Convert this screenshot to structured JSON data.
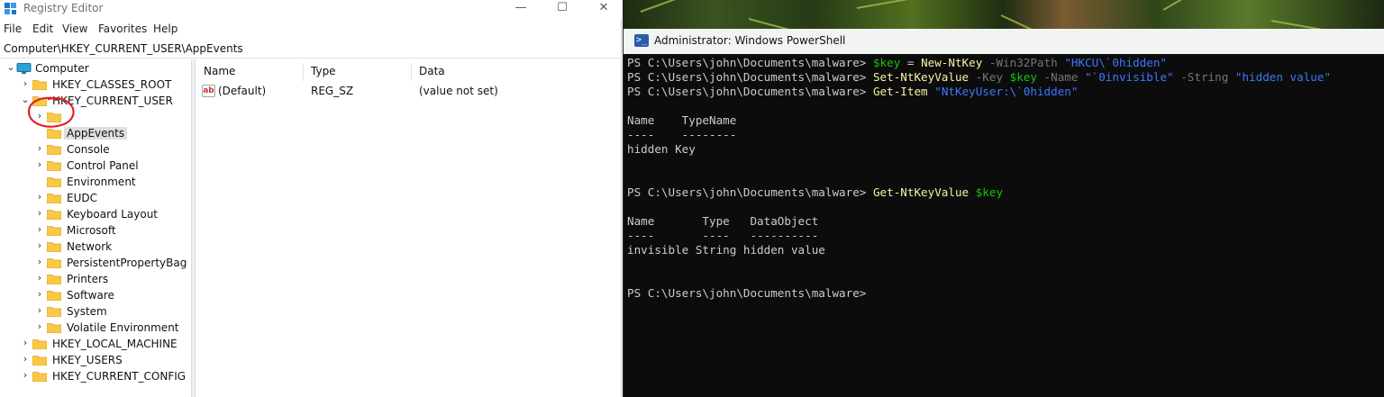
{
  "regedit": {
    "title": "Registry Editor",
    "window_buttons": {
      "minimize": "—",
      "maximize": "☐",
      "close": "✕"
    },
    "menu": [
      "File",
      "Edit",
      "View",
      "Favorites",
      "Help"
    ],
    "address": "Computer\\HKEY_CURRENT_USER\\AppEvents",
    "tree": {
      "root": "Computer",
      "hives": [
        "HKEY_CLASSES_ROOT",
        "HKEY_CURRENT_USER"
      ],
      "hkcu_children": [
        "",
        "AppEvents",
        "Console",
        "Control Panel",
        "Environment",
        "EUDC",
        "Keyboard Layout",
        "Microsoft",
        "Network",
        "PersistentPropertyBag",
        "Printers",
        "Software",
        "System",
        "Volatile Environment"
      ],
      "other_hives": [
        "HKEY_LOCAL_MACHINE",
        "HKEY_USERS",
        "HKEY_CURRENT_CONFIG"
      ],
      "selected": "AppEvents"
    },
    "list": {
      "columns": [
        "Name",
        "Type",
        "Data"
      ],
      "rows": [
        {
          "icon": "ab",
          "name": "(Default)",
          "type": "REG_SZ",
          "data": "(value not set)"
        }
      ]
    },
    "annotation_color": "#e0202a"
  },
  "powershell": {
    "title": "Administrator: Windows PowerShell",
    "icon_glyph": ">_",
    "lines": [
      [
        {
          "t": "PS C:\\Users\\john\\Documents\\malware> ",
          "c": "op"
        },
        {
          "t": "$key",
          "c": "var"
        },
        {
          "t": " = ",
          "c": "op"
        },
        {
          "t": "New-NtKey",
          "c": "cmd"
        },
        {
          "t": " -Win32Path ",
          "c": "param"
        },
        {
          "t": "\"HKCU\\`0hidden\"",
          "c": "str"
        }
      ],
      [
        {
          "t": "PS C:\\Users\\john\\Documents\\malware> ",
          "c": "op"
        },
        {
          "t": "Set-NtKeyValue",
          "c": "cmd"
        },
        {
          "t": " -Key ",
          "c": "param"
        },
        {
          "t": "$key",
          "c": "var"
        },
        {
          "t": " -Name ",
          "c": "param"
        },
        {
          "t": "\"`0invisible\"",
          "c": "str"
        },
        {
          "t": " -String ",
          "c": "param"
        },
        {
          "t": "\"hidden value\"",
          "c": "str"
        }
      ],
      [
        {
          "t": "PS C:\\Users\\john\\Documents\\malware> ",
          "c": "op"
        },
        {
          "t": "Get-Item",
          "c": "cmd"
        },
        {
          "t": " ",
          "c": "op"
        },
        {
          "t": "\"NtKeyUser:\\`0hidden\"",
          "c": "str"
        }
      ],
      [],
      [
        {
          "t": "Name    TypeName",
          "c": "op"
        }
      ],
      [
        {
          "t": "----    --------",
          "c": "op"
        }
      ],
      [
        {
          "t": "hidden Key",
          "c": "op"
        }
      ],
      [],
      [],
      [
        {
          "t": "PS C:\\Users\\john\\Documents\\malware> ",
          "c": "op"
        },
        {
          "t": "Get-NtKeyValue",
          "c": "cmd"
        },
        {
          "t": " ",
          "c": "op"
        },
        {
          "t": "$key",
          "c": "var"
        }
      ],
      [],
      [
        {
          "t": "Name       Type   DataObject",
          "c": "op"
        }
      ],
      [
        {
          "t": "----       ----   ----------",
          "c": "op"
        }
      ],
      [
        {
          "t": "invisible String hidden value",
          "c": "op"
        }
      ],
      [],
      [],
      [
        {
          "t": "PS C:\\Users\\john\\Documents\\malware>",
          "c": "op"
        }
      ]
    ],
    "colors": {
      "background": "#0c0c0c",
      "command": "#f9f1a5",
      "variable": "#16c60c",
      "parameter": "#767676",
      "string": "#3b78ff",
      "text": "#cccccc"
    }
  }
}
